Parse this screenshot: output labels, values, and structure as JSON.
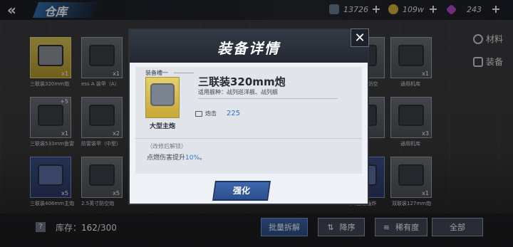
{
  "header": {
    "back_label": "«",
    "title": "仓库"
  },
  "resources": [
    {
      "icon": "fuel-icon",
      "value": "13726",
      "color": "#6a7c96"
    },
    {
      "icon": "coin-icon",
      "value": "109w",
      "color": "#d6b43a"
    },
    {
      "icon": "gem-icon",
      "value": "243",
      "color": "#b847c8"
    }
  ],
  "plus_label": "+",
  "side_tabs": [
    {
      "icon": "gear-icon",
      "label": "材料"
    },
    {
      "icon": "equipment-icon",
      "label": "装备"
    }
  ],
  "grid": {
    "left_items": [
      {
        "name": "三联装320mm炮",
        "count": "x1",
        "level": "",
        "style": "gold"
      },
      {
        "name": "ess A 装甲（A）",
        "count": "x1",
        "level": "",
        "style": "gray"
      },
      {
        "name": "三联装533mm鱼雷",
        "count": "x1",
        "level": "+5",
        "style": "gray"
      },
      {
        "name": "防雷装甲（中型）",
        "count": "x2",
        "level": "",
        "style": "gray"
      },
      {
        "name": "三联装406mm主炮",
        "count": "x5",
        "level": "",
        "style": "blue"
      },
      {
        "name": "2.5英寸防空炮",
        "count": "x5",
        "level": "",
        "style": "gray"
      }
    ],
    "right_items": [
      {
        "name": "27mm防空",
        "count": "",
        "level": "",
        "style": "gray"
      },
      {
        "name": "通用机库",
        "count": "x1",
        "level": "",
        "style": "gray"
      },
      {
        "name": "",
        "count": "",
        "level": "",
        "style": "gray"
      },
      {
        "name": "通用机库",
        "count": "x3",
        "level": "",
        "style": "gray"
      },
      {
        "name": "3(0)鱼雷轰炸",
        "count": "",
        "level": "",
        "style": "blue"
      },
      {
        "name": "双联装127mm炮",
        "count": "x1",
        "level": "",
        "style": "gray"
      }
    ]
  },
  "modal": {
    "title": "装备详情",
    "close_label": "✕",
    "slot_label": "装备槽一",
    "item_name": "三联装320mm炮",
    "item_type": "大型主炮",
    "ships_label": "适用舰种：",
    "ships": "战列巡洋舰、战列舰",
    "stat_label": "炮击",
    "stat_value": "225",
    "bonus_title": "（改修后解锁）",
    "bonus_prefix": "点燃伤害提升",
    "bonus_value": "10%",
    "bonus_suffix": "。",
    "upgrade_label": "强化"
  },
  "footer": {
    "help_label": "?",
    "capacity_label": "库存：",
    "capacity_used": "162",
    "capacity_total": "/300",
    "batch_button": "批量拆解",
    "sort_button": "降序",
    "rarity_button": "稀有度",
    "filter_button": "全部"
  }
}
